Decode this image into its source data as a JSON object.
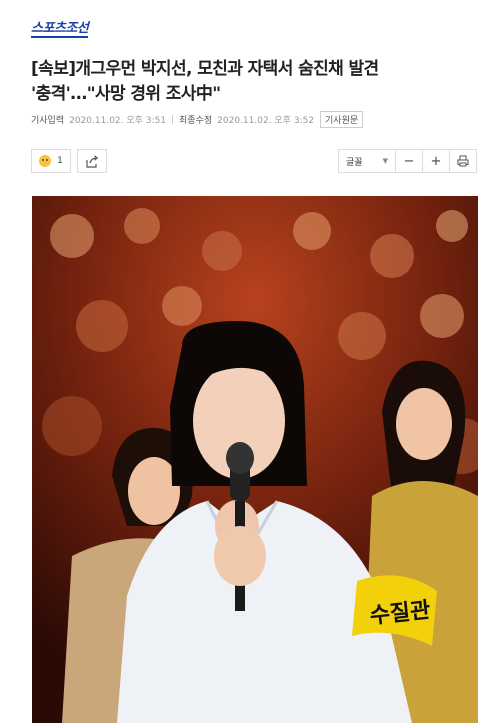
{
  "site": {
    "logo_text": "스포츠조선"
  },
  "article": {
    "headline_line1": "[속보]개그우먼 박지선, 모친과 자택서 숨진채 발견",
    "headline_line2": "'충격'…\"사망 경위 조사中\"",
    "published_label": "기사입력",
    "published_value": "2020.11.02. 오후 3:51",
    "modified_label": "최종수정",
    "modified_value": "2020.11.02. 오후 3:52",
    "original_link": "기사원문"
  },
  "toolbar": {
    "reaction_count": "1",
    "reaction_icon": "sad-face-icon",
    "share_icon": "share-icon",
    "font_label": "글꼴",
    "font_decrease": "−",
    "font_increase": "+",
    "print_icon": "print-icon"
  },
  "photo": {
    "armband_text": "수질관"
  },
  "colors": {
    "logo_blue": "#1a3fa8",
    "armband_yellow": "#f2d10a"
  }
}
